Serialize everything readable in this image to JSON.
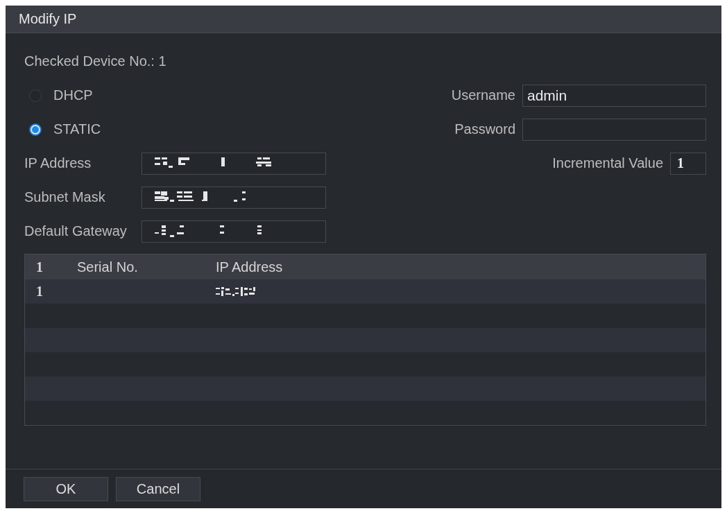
{
  "window": {
    "title": "Modify IP"
  },
  "checked_device": "Checked Device No.: 1",
  "ip_mode": [
    {
      "label": "DHCP",
      "selected": false
    },
    {
      "label": "STATIC",
      "selected": true
    }
  ],
  "address_fields": [
    {
      "label": "IP Address",
      "redacted": true
    },
    {
      "label": "Subnet Mask",
      "redacted": true
    },
    {
      "label": "Default Gateway",
      "redacted": true
    }
  ],
  "credentials": [
    {
      "label": "Username",
      "kind": "text",
      "value": "admin"
    },
    {
      "label": "Password",
      "kind": "password"
    }
  ],
  "incremental_value": {
    "label": "Incremental Value",
    "value": "1"
  },
  "table": {
    "columns": [
      "1",
      "Serial No.",
      "IP Address"
    ],
    "rows": [
      {
        "index": "1",
        "ip_address_redacted": true
      }
    ]
  },
  "buttons": [
    "OK",
    "Cancel"
  ]
}
